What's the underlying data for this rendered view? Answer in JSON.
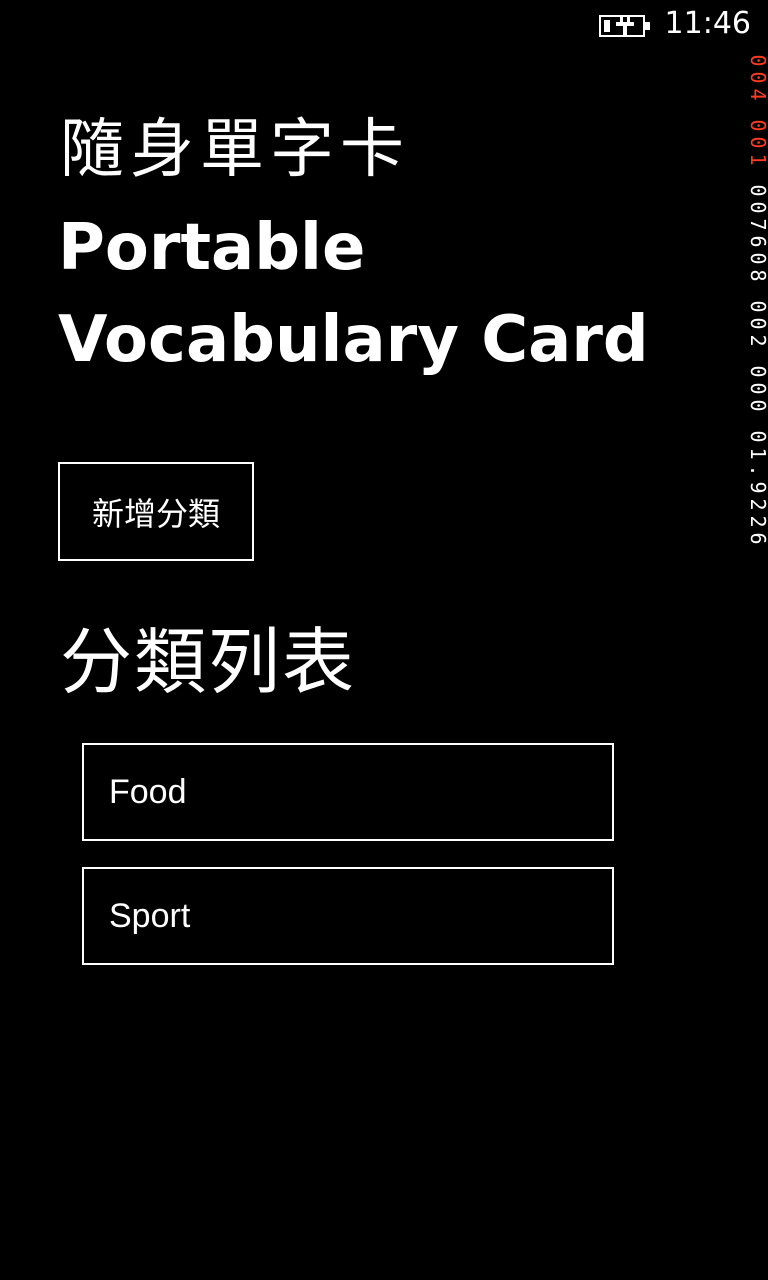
{
  "status_bar": {
    "time": "11:46",
    "battery_icon": "battery-charging-icon"
  },
  "header": {
    "title_cn": "隨身單字卡",
    "title_en": "Portable Vocabulary Card"
  },
  "actions": {
    "add_category_label": "新增分類"
  },
  "section": {
    "title": "分類列表"
  },
  "categories": [
    {
      "label": "Food"
    },
    {
      "label": "Sport"
    }
  ],
  "debug_counters": {
    "colors": {
      "accent": "#ff3b1f",
      "normal": "#ffffff"
    },
    "groups": [
      "004",
      "001",
      "007608",
      "002",
      "000",
      "01.9226"
    ]
  }
}
